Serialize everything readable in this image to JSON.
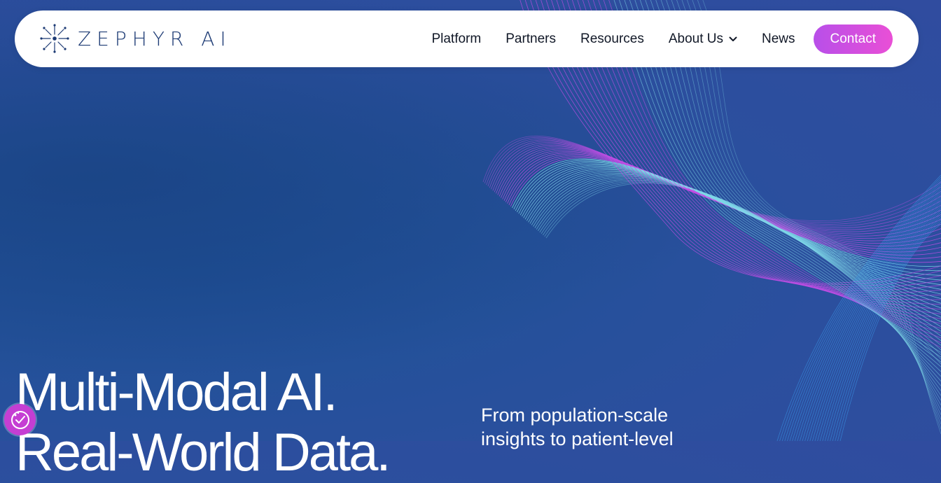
{
  "brand": {
    "name": "ZEPHYR AI"
  },
  "nav": {
    "items": [
      {
        "label": "Platform"
      },
      {
        "label": "Partners"
      },
      {
        "label": "Resources"
      },
      {
        "label": "About Us",
        "has_dropdown": true
      },
      {
        "label": "News"
      }
    ],
    "contact_label": "Contact"
  },
  "hero": {
    "title_line1": "Multi-Modal AI.",
    "title_line2": "Real-World Data.",
    "subtitle_line1": "From population-scale",
    "subtitle_line2": "insights to patient-level"
  },
  "icons": {
    "logo": "starburst-logo-icon",
    "dropdown": "chevron-down-icon",
    "accessibility": "accessibility-icon"
  },
  "colors": {
    "background": "#2a509c",
    "brand_text": "#1c3a74",
    "contact_gradient_start": "#b84fe9",
    "contact_gradient_end": "#e94fd6",
    "accessibility_button": "#c53ed3",
    "wave_magenta": "#c44ee6",
    "wave_cyan": "#7fd8e8"
  }
}
